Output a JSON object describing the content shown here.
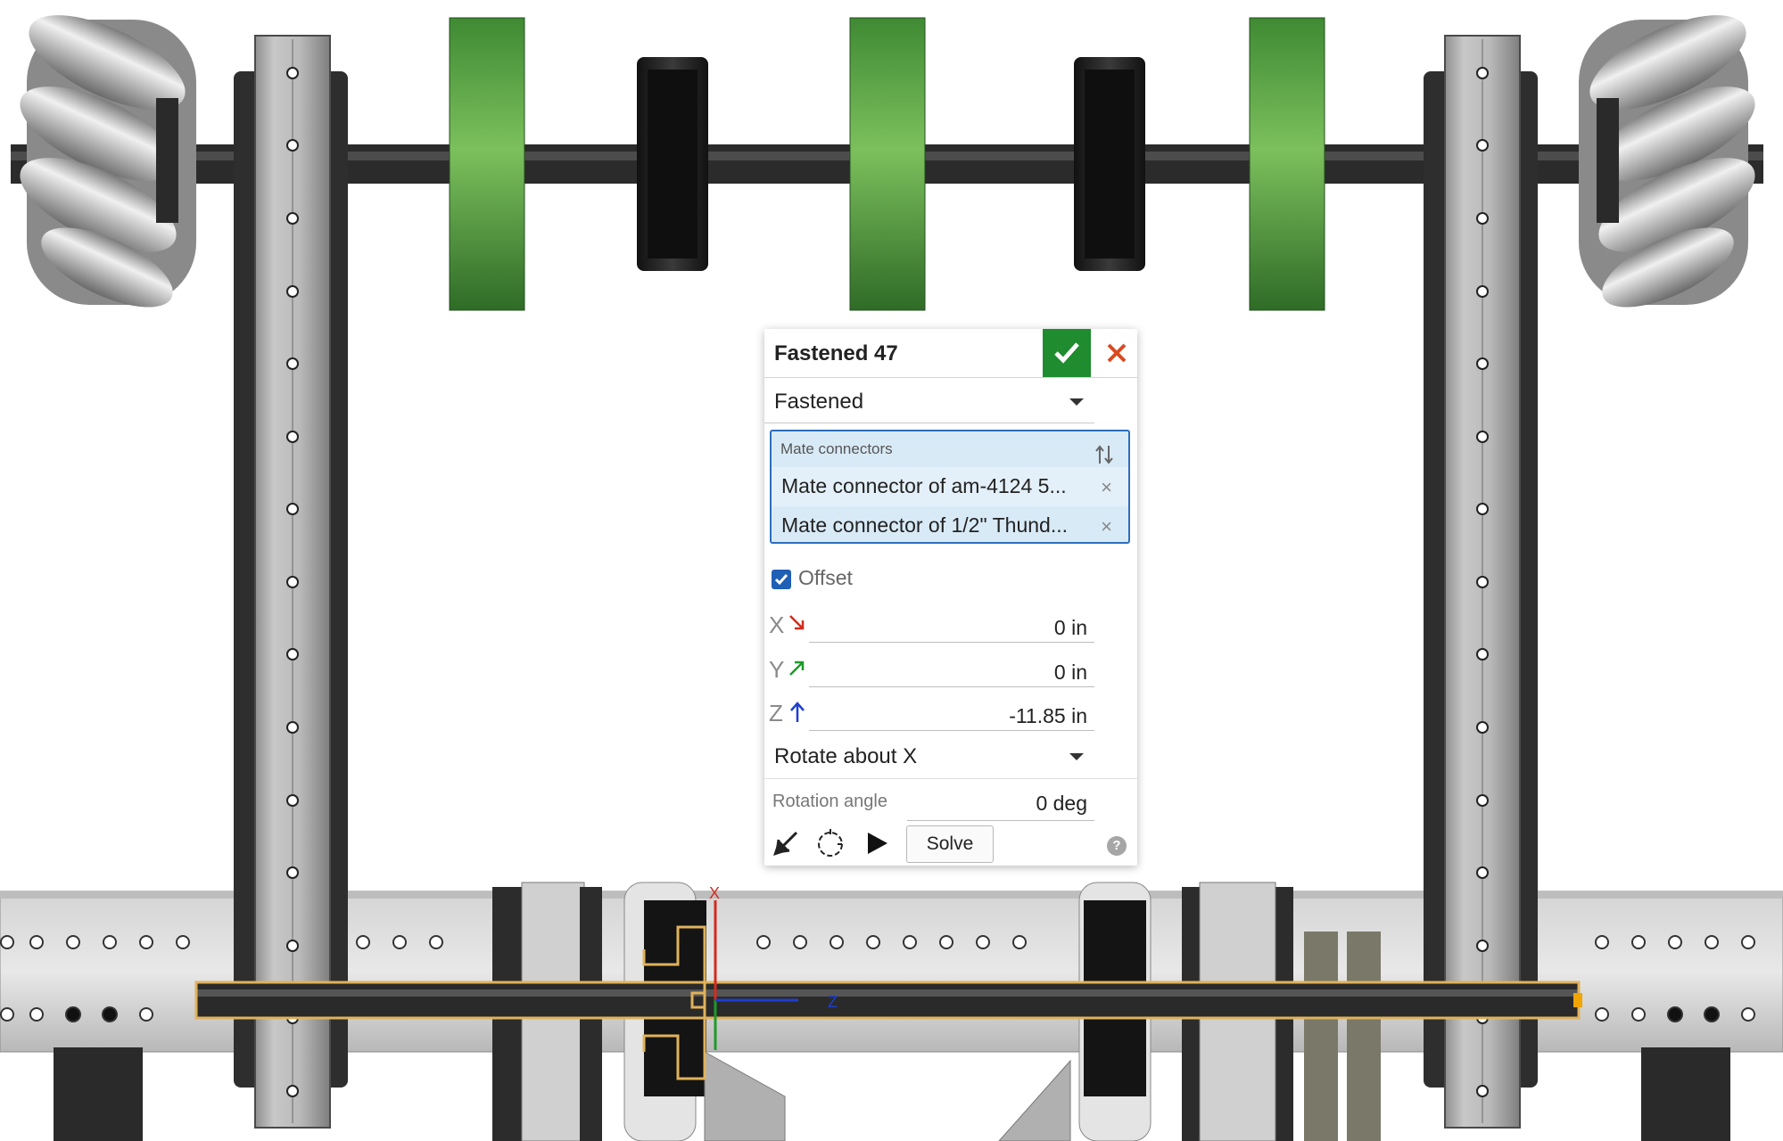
{
  "dialog": {
    "title": "Fastened 47",
    "mate_type": "Fastened",
    "mate_connectors": {
      "header": "Mate connectors",
      "items": [
        "Mate connector of am-4124 5...",
        "Mate connector of 1/2\" Thund..."
      ]
    },
    "offset": {
      "label": "Offset",
      "checked": true
    },
    "x": {
      "axis": "X",
      "value": "0 in"
    },
    "y": {
      "axis": "Y",
      "value": "0 in"
    },
    "z": {
      "axis": "Z",
      "value": "-11.85 in"
    },
    "rotation_axis": "Rotate about X",
    "rotation_angle": {
      "label": "Rotation angle",
      "value": "0 deg"
    },
    "solve_label": "Solve",
    "help_glyph": "?"
  },
  "viewport": {
    "triad_labels": {
      "x": "X",
      "z": "Z"
    }
  },
  "colors": {
    "accept": "#1e8c2f",
    "cancel": "#d94a21",
    "selection_highlight": "#e0b25a",
    "green_wheel": "#4f9a3a",
    "plate_gray": "#a9a9a9"
  },
  "icons": [
    "checkmark-icon",
    "close-icon",
    "dropdown-caret-icon",
    "flip-primary-axis-icon",
    "remove-icon",
    "checkbox-checked-icon",
    "arrow-icon",
    "animate-icon",
    "play-icon",
    "help-icon"
  ]
}
